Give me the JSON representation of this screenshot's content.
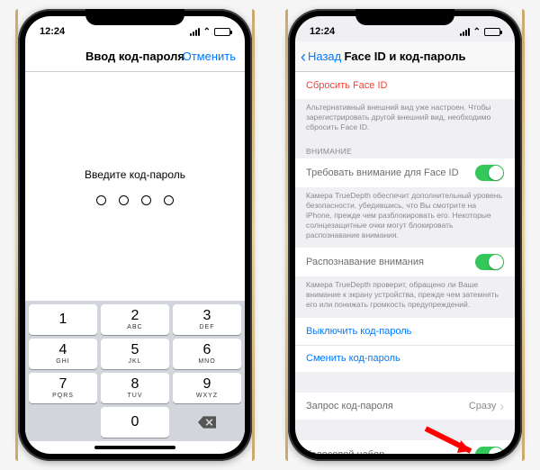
{
  "status": {
    "time": "12:24",
    "netIcon": "↗",
    "battery": "charging"
  },
  "left": {
    "title": "Ввод код-пароля",
    "cancel": "Отменить",
    "prompt": "Введите код-пароль",
    "keys": [
      {
        "n": "1",
        "l": ""
      },
      {
        "n": "2",
        "l": "ABC"
      },
      {
        "n": "3",
        "l": "DEF"
      },
      {
        "n": "4",
        "l": "GHI"
      },
      {
        "n": "5",
        "l": "JKL"
      },
      {
        "n": "6",
        "l": "MNO"
      },
      {
        "n": "7",
        "l": "PQRS"
      },
      {
        "n": "8",
        "l": "TUV"
      },
      {
        "n": "9",
        "l": "WXYZ"
      },
      {
        "n": "",
        "l": ""
      },
      {
        "n": "0",
        "l": ""
      },
      {
        "n": "del",
        "l": ""
      }
    ]
  },
  "right": {
    "back": "Назад",
    "title": "Face ID и код-пароль",
    "resetFaceId": "Сбросить Face ID",
    "resetFooter": "Альтернативный внешний вид уже настроен. Чтобы зарегистрировать другой внешний вид, необходимо сбросить Face ID.",
    "attentionHeader": "ВНИМАНИЕ",
    "requireAttention": "Требовать внимание для Face ID",
    "requireAttentionFooter": "Камера TrueDepth обеспечит дополнительный уровень безопасности, убедившись, что Вы смотрите на iPhone, прежде чем разблокировать его. Некоторые солнцезащитные очки могут блокировать распознавание внимания.",
    "attentionAware": "Распознавание внимания",
    "attentionAwareFooter": "Камера TrueDepth проверит, обращено ли Ваше внимание к экрану устройства, прежде чем затемнять его или понижать громкость предупреждений.",
    "turnOffPasscode": "Выключить код-пароль",
    "changePasscode": "Сменить код-пароль",
    "requirePasscode": "Запрос код-пароля",
    "requirePasscodeValue": "Сразу",
    "voiceDial": "Голосовой набор"
  }
}
